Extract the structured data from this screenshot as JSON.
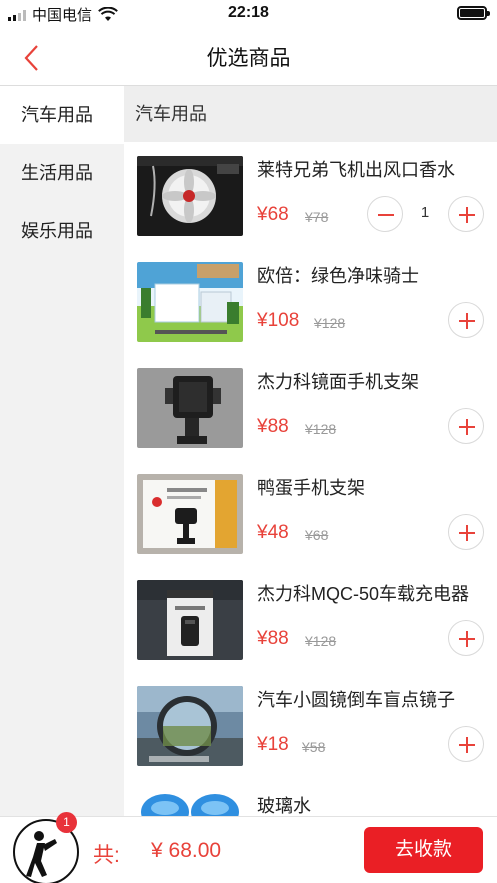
{
  "status_bar": {
    "carrier": "中国电信",
    "time": "22:18"
  },
  "nav": {
    "title": "优选商品"
  },
  "sidebar": {
    "items": [
      {
        "label": "汽车用品",
        "active": true
      },
      {
        "label": "生活用品",
        "active": false
      },
      {
        "label": "娱乐用品",
        "active": false
      }
    ]
  },
  "section": {
    "title": "汽车用品"
  },
  "products": [
    {
      "name": "莱特兄弟飞机出风口香水",
      "price": "¥68",
      "original_price": "¥78",
      "quantity": "1"
    },
    {
      "name": "欧倍：绿色净味骑士",
      "price": "¥108",
      "original_price": "¥128"
    },
    {
      "name": "杰力科镜面手机支架",
      "price": "¥88",
      "original_price": "¥128"
    },
    {
      "name": "鸭蛋手机支架",
      "price": "¥48",
      "original_price": "¥68"
    },
    {
      "name": "杰力科MQC-50车载充电器",
      "price": "¥88",
      "original_price": "¥128"
    },
    {
      "name": "汽车小圆镜倒车盲点镜子",
      "price": "¥18",
      "original_price": "¥58"
    },
    {
      "name": "玻璃水",
      "price": "",
      "original_price": ""
    }
  ],
  "cart": {
    "badge_count": "1",
    "total_label": "共:",
    "total_value": "¥ 68.00",
    "checkout_label": "去收款"
  },
  "colors": {
    "accent": "#e8423a",
    "button": "#ea1f25",
    "sidebar_bg": "#f2f2f2"
  },
  "icons": {
    "back": "chevron-left-icon",
    "plus": "plus-icon",
    "minus": "minus-icon"
  }
}
